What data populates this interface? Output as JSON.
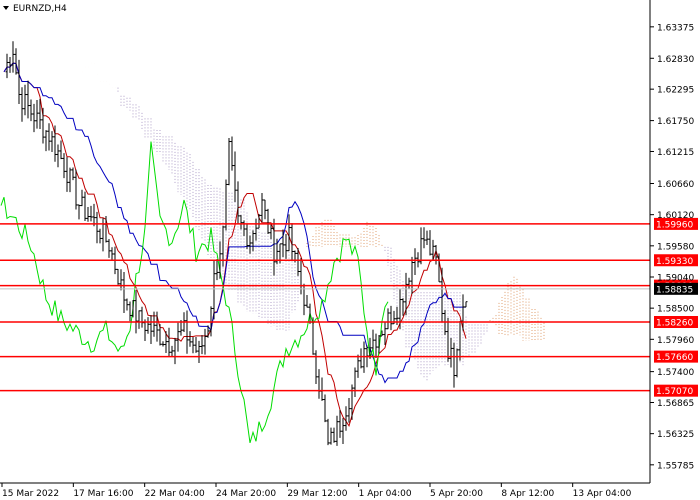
{
  "header": {
    "symbol_label": "EURNZD,H4"
  },
  "colors": {
    "background": "#ffffff",
    "bar": "#000000",
    "support_resistance": "#ff0000",
    "tenkan": "#c00000",
    "kijun": "#0000c0",
    "chikou": "#00dd00",
    "kumo_a": "#e0a070",
    "kumo_b": "#b0a0c8",
    "grid_line": "#c0c0c0"
  },
  "chart_data": {
    "type": "ohlc",
    "instrument": "EURNZD",
    "timeframe": "H4",
    "ylim": [
      1.5547,
      1.6384
    ],
    "y_ticks": [
      "1.63375",
      "1.62830",
      "1.62295",
      "1.61750",
      "1.61215",
      "1.60660",
      "1.60120",
      "1.59580",
      "1.59040",
      "1.58500",
      "1.57960",
      "1.57400",
      "1.56865",
      "1.56325",
      "1.55785"
    ],
    "x_ticks": [
      "15 Mar 2022",
      "17 Mar 16:00",
      "22 Mar 04:00",
      "24 Mar 20:00",
      "29 Mar 12:00",
      "1 Apr 04:00",
      "5 Apr 20:00",
      "8 Apr 12:00",
      "13 Apr 04:00"
    ],
    "levels": [
      {
        "label": "1.59960",
        "value": 1.5996
      },
      {
        "label": "1.59330",
        "value": 1.5933
      },
      {
        "label": "1.58890",
        "value": 1.5889
      },
      {
        "label": "1.58260",
        "value": 1.5826
      },
      {
        "label": "1.57660",
        "value": 1.5766
      },
      {
        "label": "1.57070",
        "value": 1.5707
      }
    ],
    "current_price": {
      "label": "1.58835",
      "value": 1.58835
    },
    "indicators": [
      "tenkan",
      "kijun",
      "chikou",
      "kumo"
    ],
    "price_path": [
      [
        0,
        1.626
      ],
      [
        3,
        1.63
      ],
      [
        5,
        1.622
      ],
      [
        9,
        1.619
      ],
      [
        15,
        1.615
      ],
      [
        20,
        1.61
      ],
      [
        25,
        1.603
      ],
      [
        30,
        1.6
      ],
      [
        35,
        1.596
      ],
      [
        40,
        1.587
      ],
      [
        45,
        1.583
      ],
      [
        50,
        1.581
      ],
      [
        55,
        1.579
      ],
      [
        60,
        1.581
      ],
      [
        65,
        1.577
      ],
      [
        68,
        1.582
      ],
      [
        70,
        1.59
      ],
      [
        73,
        1.598
      ],
      [
        75,
        1.612
      ],
      [
        78,
        1.6
      ],
      [
        82,
        1.597
      ],
      [
        86,
        1.603
      ],
      [
        90,
        1.595
      ],
      [
        95,
        1.597
      ],
      [
        100,
        1.587
      ],
      [
        105,
        1.572
      ],
      [
        108,
        1.561
      ],
      [
        112,
        1.565
      ],
      [
        116,
        1.571
      ],
      [
        120,
        1.578
      ],
      [
        124,
        1.58
      ],
      [
        128,
        1.583
      ],
      [
        132,
        1.586
      ],
      [
        136,
        1.593
      ],
      [
        140,
        1.597
      ],
      [
        144,
        1.593
      ],
      [
        146,
        1.585
      ],
      [
        148,
        1.578
      ],
      [
        150,
        1.575
      ],
      [
        152,
        1.584
      ],
      [
        154,
        1.588
      ]
    ]
  }
}
